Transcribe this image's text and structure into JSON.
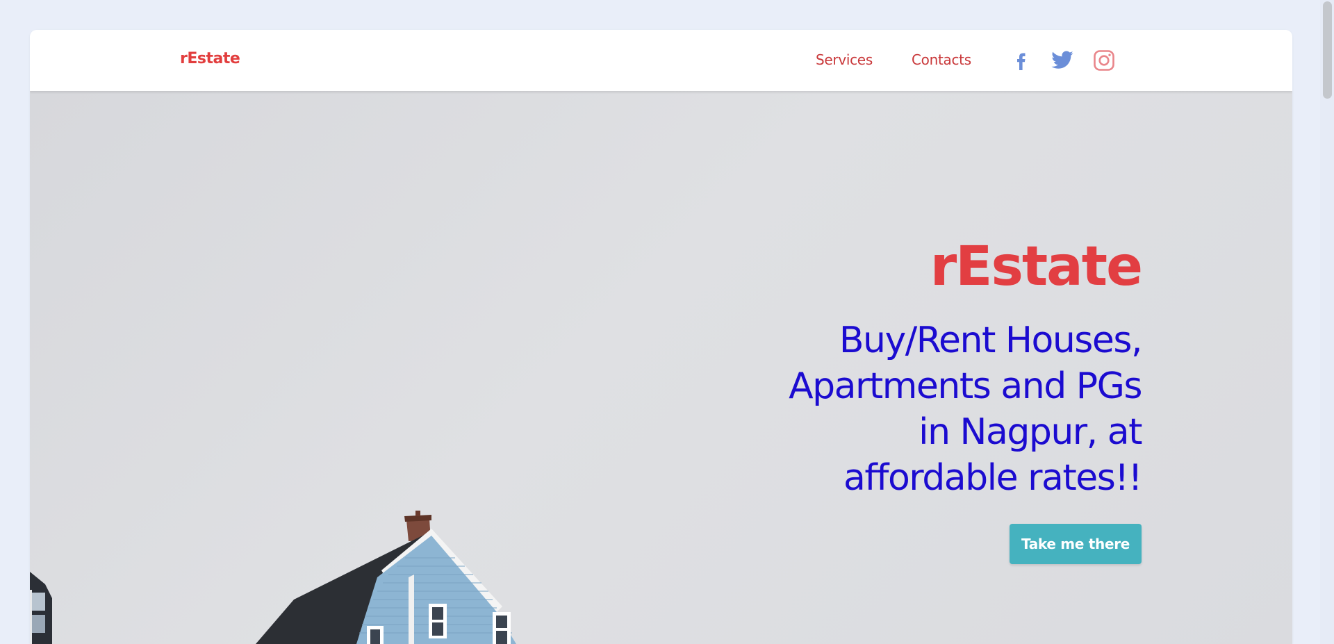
{
  "nav": {
    "brand": "rEstate",
    "links": [
      {
        "label": "Services"
      },
      {
        "label": "Contacts"
      }
    ],
    "social": [
      {
        "icon": "facebook-icon",
        "color": "#6b8ed8"
      },
      {
        "icon": "twitter-icon",
        "color": "#6b8ed8"
      },
      {
        "icon": "instagram-icon",
        "color": "#e9858a"
      }
    ]
  },
  "hero": {
    "title": "rEstate",
    "subtitle": "Buy/Rent Houses, Apartments and PGs in Nagpur, at affordable rates!!",
    "cta_label": "Take me there",
    "image": "tilted-blue-house-photo"
  },
  "colors": {
    "brand": "#e23e3e",
    "subtitle": "#1b0bd0",
    "cta": "#45b2bf",
    "page_bg": "#e9eef9"
  }
}
